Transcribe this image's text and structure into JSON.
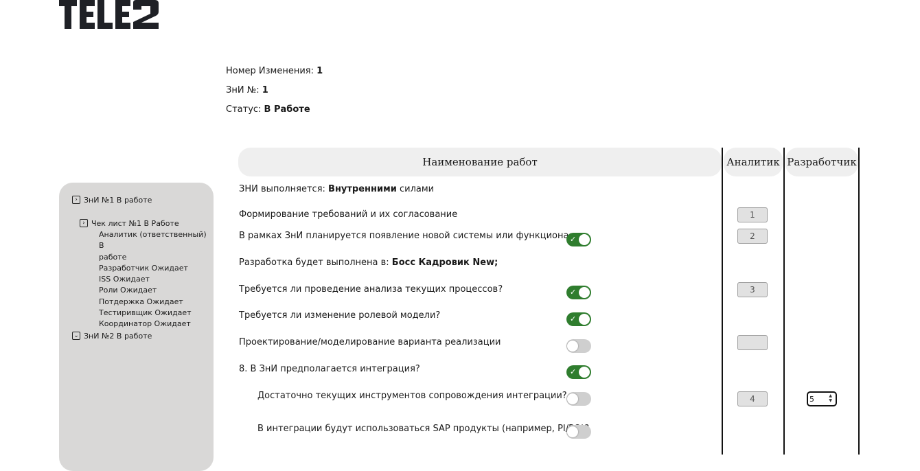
{
  "logo": {
    "text": "TELE2"
  },
  "header": {
    "change_number_label": "Номер Изменения: ",
    "change_number_value": "1",
    "zni_label": "ЗнИ №: ",
    "zni_value": "1",
    "status_label": "Статус: ",
    "status_value": "В Работе"
  },
  "sidebar": {
    "tree": [
      {
        "label": "ЗнИ №1 В работе",
        "icon": "chevron-right-icon",
        "expanded": false
      },
      {
        "label": "Чек лист №1 В Работе",
        "icon": "chevron-right-icon",
        "expanded": false
      },
      {
        "label": "ЗнИ №2 В работе",
        "icon": "chevron-down-icon",
        "expanded": true
      }
    ],
    "checklist_items": [
      "Аналитик (ответственный) В",
      "работе",
      "Разработчик Ожидает",
      "ISS Ожидает",
      "Роли Ожидает",
      "Потдержка Ожидает",
      "Тестиривщик Ожидает",
      "Координатор Ожидает"
    ]
  },
  "table": {
    "headers": {
      "name": "Наименование работ",
      "analyst": "Аналитик",
      "developer": "Разработчик"
    },
    "rows": [
      {
        "pre": "ЗНИ выполняется: ",
        "bold": "Внутренними",
        "post": " силами"
      },
      {
        "label": "Формирование требований и их согласование",
        "analyst": "1"
      },
      {
        "label": "В рамках ЗнИ планируется появление новой системы или функционала",
        "toggle": true,
        "analyst": "2"
      },
      {
        "pre": "Разработка будет выполнена в: ",
        "bold": "Босс Кадровик New;"
      },
      {
        "label": "Требуется ли проведение анализа текущих процессов?",
        "toggle": true,
        "analyst": "3"
      },
      {
        "label": "Требуется ли изменение ролевой модели?",
        "toggle": true
      },
      {
        "label": "Проектирование/моделирование варианта реализации",
        "toggle": false,
        "analyst": ""
      },
      {
        "label": "8. В ЗнИ предполагается интеграция?",
        "toggle": true
      },
      {
        "label": "Достаточно текущих инструментов сопровождения интеграции?",
        "toggle": false,
        "analyst": "4",
        "developer": "5"
      },
      {
        "label": "В интеграции будут использоваться SAP продукты (например, PI/PO)?",
        "toggle": false
      }
    ]
  },
  "colors": {
    "toggle_on": "#2f7d2e",
    "toggle_off": "#cfcfcf",
    "sidebar_bg": "#d9d8d7",
    "header_bg": "#efefef"
  }
}
